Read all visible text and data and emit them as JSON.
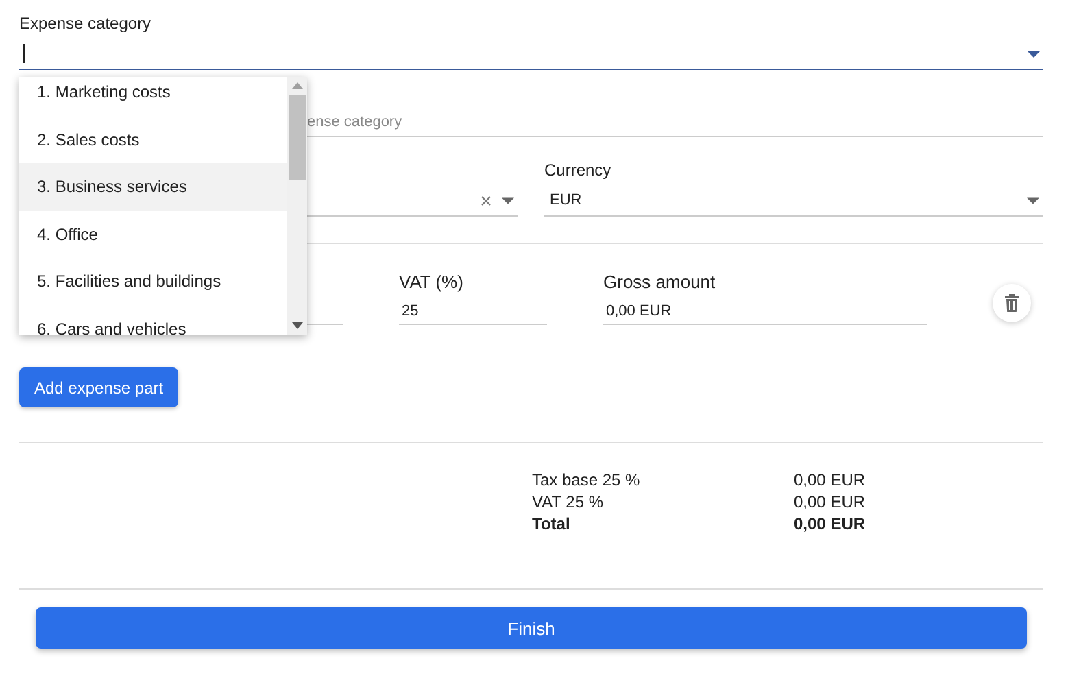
{
  "category_field": {
    "label": "Expense category"
  },
  "category_menu": {
    "items": [
      {
        "label": "1. Marketing costs",
        "selected": false
      },
      {
        "label": "2. Sales costs",
        "selected": false
      },
      {
        "label": "3. Business services",
        "selected": true
      },
      {
        "label": "4. Office",
        "selected": false
      },
      {
        "label": "5. Facilities and buildings",
        "selected": false
      },
      {
        "label": "6. Cars and vehicles",
        "selected": false
      }
    ]
  },
  "subcategory_field": {
    "placeholder": "ense category"
  },
  "currency_field": {
    "label": "Currency",
    "value": "EUR"
  },
  "expense_part": {
    "vat": {
      "label": "VAT (%)",
      "value": "25"
    },
    "gross": {
      "label": "Gross amount",
      "value": "0,00 EUR"
    }
  },
  "add_button": "Add expense part",
  "totals": [
    {
      "kind": "line",
      "label": "Tax base 25 %",
      "value": "0,00 EUR"
    },
    {
      "kind": "line",
      "label": "VAT 25 %",
      "value": "0,00 EUR"
    },
    {
      "kind": "total",
      "label": "Total",
      "value": "0,00 EUR"
    }
  ],
  "finish_button": "Finish"
}
